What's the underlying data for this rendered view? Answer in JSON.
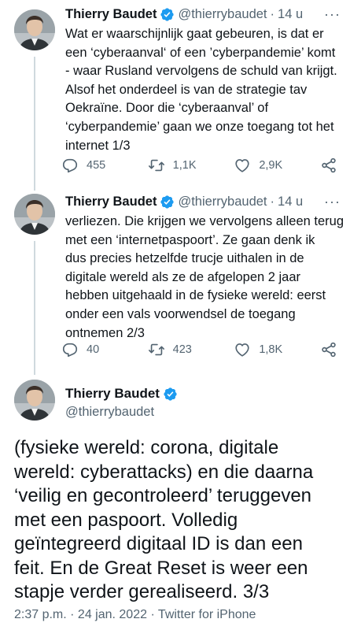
{
  "tweets": [
    {
      "name": "Thierry Baudet",
      "handle": "@thierrybaudet",
      "sep": "·",
      "time": "14 u",
      "more": "···",
      "lines": [
        "Wat er waarschijnlijk gaat gebeuren, is dat er",
        "een ‘cyberaanval‘ of een ’cyberpandemie’ komt",
        "- waar Rusland vervolgens de schuld van krijgt.",
        "Alsof het onderdeel is van de strategie tav",
        "Oekraïne. Door die ‘cyberaanval’ of",
        "‘cyberpandemie’ gaan we onze toegang tot het",
        "internet 1/3"
      ],
      "replies": "455",
      "retweets": "1,1K",
      "likes": "2,9K"
    },
    {
      "name": "Thierry Baudet",
      "handle": "@thierrybaudet",
      "sep": "·",
      "time": "14 u",
      "more": "···",
      "lines": [
        "verliezen. Die krijgen we vervolgens alleen terug",
        "met een ‘internetpaspoort’. Ze gaan denk ik",
        "dus precies hetzelfde trucje uithalen in de",
        "digitale wereld als ze de afgelopen 2 jaar",
        "hebben uitgehaald in de fysieke wereld: eerst",
        "onder een vals voorwendsel de toegang",
        "ontnemen 2/3"
      ],
      "replies": "40",
      "retweets": "423",
      "likes": "1,8K"
    }
  ],
  "main_tweet": {
    "name": "Thierry Baudet",
    "handle": "@thierrybaudet",
    "lines": [
      "(fysieke wereld: corona, digitale",
      "wereld: cyberattacks) en die daarna",
      "‘veilig en gecontroleerd’ teruggeven",
      "met een paspoort. Volledig",
      "geïntegreerd digitaal ID is dan een",
      "feit. En de Great Reset is weer een",
      "stapje verder gerealiseerd. 3/3"
    ],
    "meta": "2:37 p.m. · 24 jan. 2022 · Twitter for iPhone"
  },
  "colors": {
    "verified": "#1d9bf0",
    "secondary_text": "#536471",
    "thread_line": "#cfd9de"
  },
  "icons": [
    "verified-badge-icon",
    "reply-icon",
    "retweet-icon",
    "like-icon",
    "share-icon",
    "more-icon"
  ]
}
